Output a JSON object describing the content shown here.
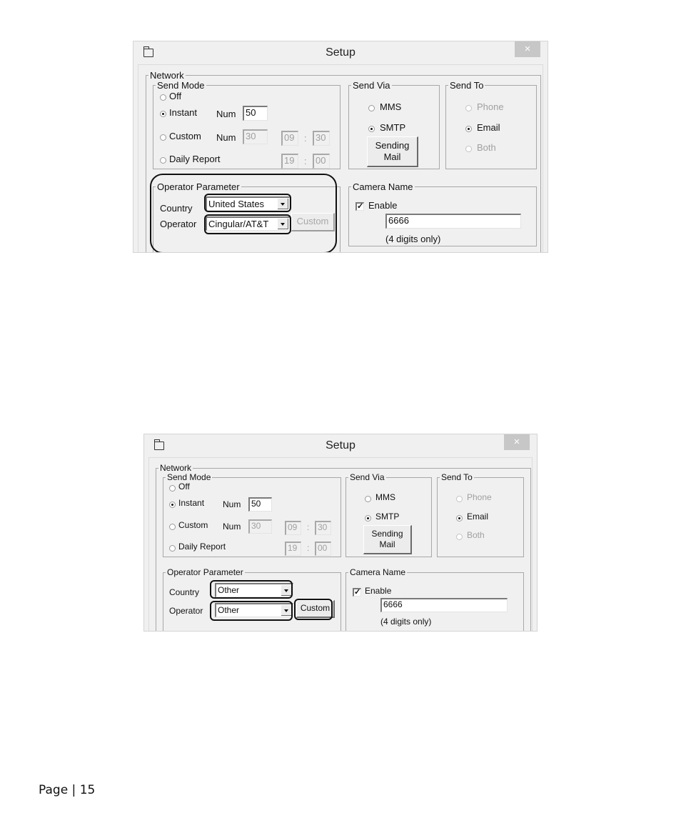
{
  "windows": [
    {
      "title": "Setup",
      "close_label": "×",
      "network_label": "Network",
      "send_mode": {
        "label": "Send Mode",
        "off_label": "Off",
        "instant_label": "Instant",
        "instant_num_label": "Num",
        "instant_num_value": "50",
        "custom_label": "Custom",
        "custom_num_label": "Num",
        "custom_num_value": "30",
        "custom_hour": "09",
        "custom_minute": "30",
        "daily_label": "Daily Report",
        "daily_hour": "19",
        "daily_minute": "00",
        "time_separator": ":",
        "selected": "Instant"
      },
      "send_via": {
        "label": "Send Via",
        "mms_label": "MMS",
        "smtp_label": "SMTP",
        "selected": "SMTP",
        "sending_mail_line1": "Sending",
        "sending_mail_line2": "Mail"
      },
      "send_to": {
        "label": "Send To",
        "phone_label": "Phone",
        "email_label": "Email",
        "both_label": "Both",
        "selected": "Email"
      },
      "operator_parameter": {
        "label": "Operator Parameter",
        "country_label": "Country",
        "country_value": "United States",
        "operator_label": "Operator",
        "operator_value": "Cingular/AT&T",
        "custom_button": "Custom",
        "custom_enabled": false
      },
      "camera_name": {
        "label": "Camera Name",
        "enable_label": "Enable",
        "enable_checked": true,
        "name_value": "6666",
        "hint": "(4 digits only)"
      }
    },
    {
      "title": "Setup",
      "close_label": "×",
      "network_label": "Network",
      "send_mode": {
        "label": "Send Mode",
        "off_label": "Off",
        "instant_label": "Instant",
        "instant_num_label": "Num",
        "instant_num_value": "50",
        "custom_label": "Custom",
        "custom_num_label": "Num",
        "custom_num_value": "30",
        "custom_hour": "09",
        "custom_minute": "30",
        "daily_label": "Daily Report",
        "daily_hour": "19",
        "daily_minute": "00",
        "time_separator": ":",
        "selected": "Instant"
      },
      "send_via": {
        "label": "Send Via",
        "mms_label": "MMS",
        "smtp_label": "SMTP",
        "selected": "SMTP",
        "sending_mail_line1": "Sending",
        "sending_mail_line2": "Mail"
      },
      "send_to": {
        "label": "Send To",
        "phone_label": "Phone",
        "email_label": "Email",
        "both_label": "Both",
        "selected": "Email"
      },
      "operator_parameter": {
        "label": "Operator Parameter",
        "country_label": "Country",
        "country_value": "Other",
        "operator_label": "Operator",
        "operator_value": "Other",
        "custom_button": "Custom",
        "custom_enabled": true
      },
      "camera_name": {
        "label": "Camera Name",
        "enable_label": "Enable",
        "enable_checked": true,
        "name_value": "6666",
        "hint": "(4 digits only)"
      }
    }
  ],
  "footer": {
    "page_label": "Page | 15"
  }
}
